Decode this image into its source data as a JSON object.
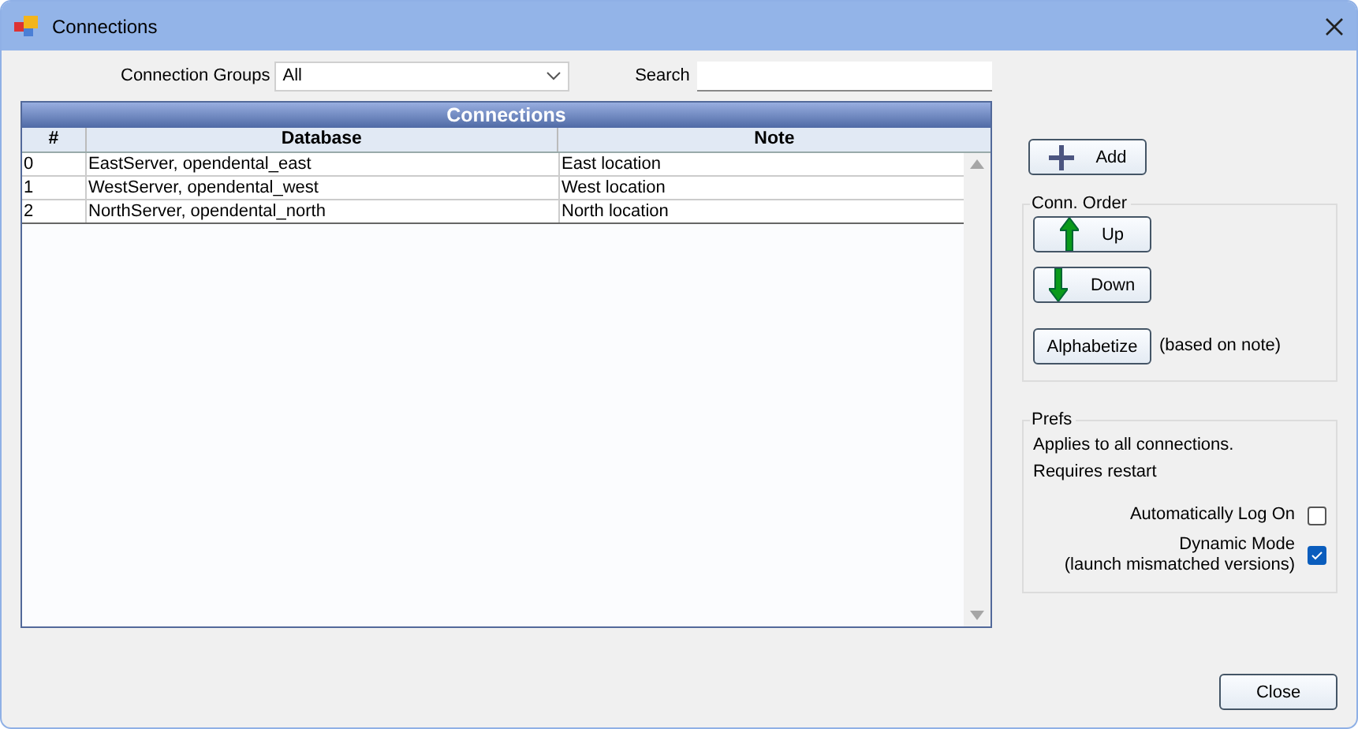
{
  "window": {
    "title": "Connections"
  },
  "filters": {
    "group_label": "Connection Groups",
    "group_value": "All",
    "search_label": "Search"
  },
  "grid": {
    "title": "Connections",
    "columns": [
      "#",
      "Database",
      "Note"
    ],
    "rows": [
      {
        "cells": [
          "0",
          "EastServer, opendental_east",
          "East location"
        ],
        "selected": false
      },
      {
        "cells": [
          "1",
          "WestServer, opendental_west",
          "West location"
        ],
        "selected": false
      },
      {
        "cells": [
          "2",
          "NorthServer, opendental_north",
          "North location"
        ],
        "selected": false
      }
    ]
  },
  "add_button": "Add",
  "order": {
    "title": "Conn. Order",
    "up": "Up",
    "down": "Down",
    "alphabetize": "Alphabetize",
    "alphabetize_note": "(based on note)"
  },
  "prefs": {
    "title": "Prefs",
    "notes": [
      "Applies to all connections.",
      "Requires restart"
    ],
    "options": [
      {
        "label": "Automatically Log On",
        "checked": false
      },
      {
        "label": "Dynamic Mode",
        "sublabel": "(launch mismatched versions)",
        "checked": true
      }
    ]
  },
  "close_button": "Close"
}
